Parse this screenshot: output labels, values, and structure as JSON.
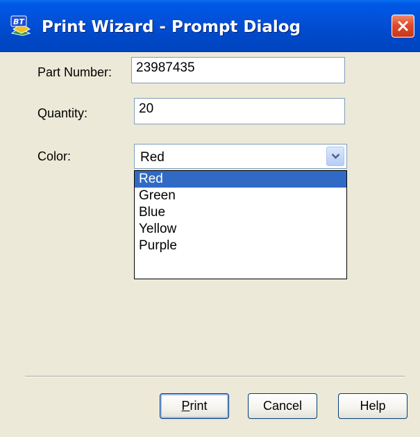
{
  "window": {
    "title": "Print Wizard - Prompt Dialog",
    "icon": "bartender-app-icon"
  },
  "form": {
    "part_number": {
      "label": "Part Number:",
      "value": "23987435"
    },
    "quantity": {
      "label": "Quantity:",
      "value": "20"
    },
    "color": {
      "label": "Color:",
      "selected": "Red",
      "options": [
        "Red",
        "Green",
        "Blue",
        "Yellow",
        "Purple"
      ]
    }
  },
  "buttons": {
    "print_mnemonic": "P",
    "print_rest": "rint",
    "cancel": "Cancel",
    "help": "Help"
  },
  "colors": {
    "titlebar": "#0250d8",
    "selection": "#316ac5",
    "dialog_bg": "#ece9d8",
    "close_button": "#e04b2a"
  }
}
